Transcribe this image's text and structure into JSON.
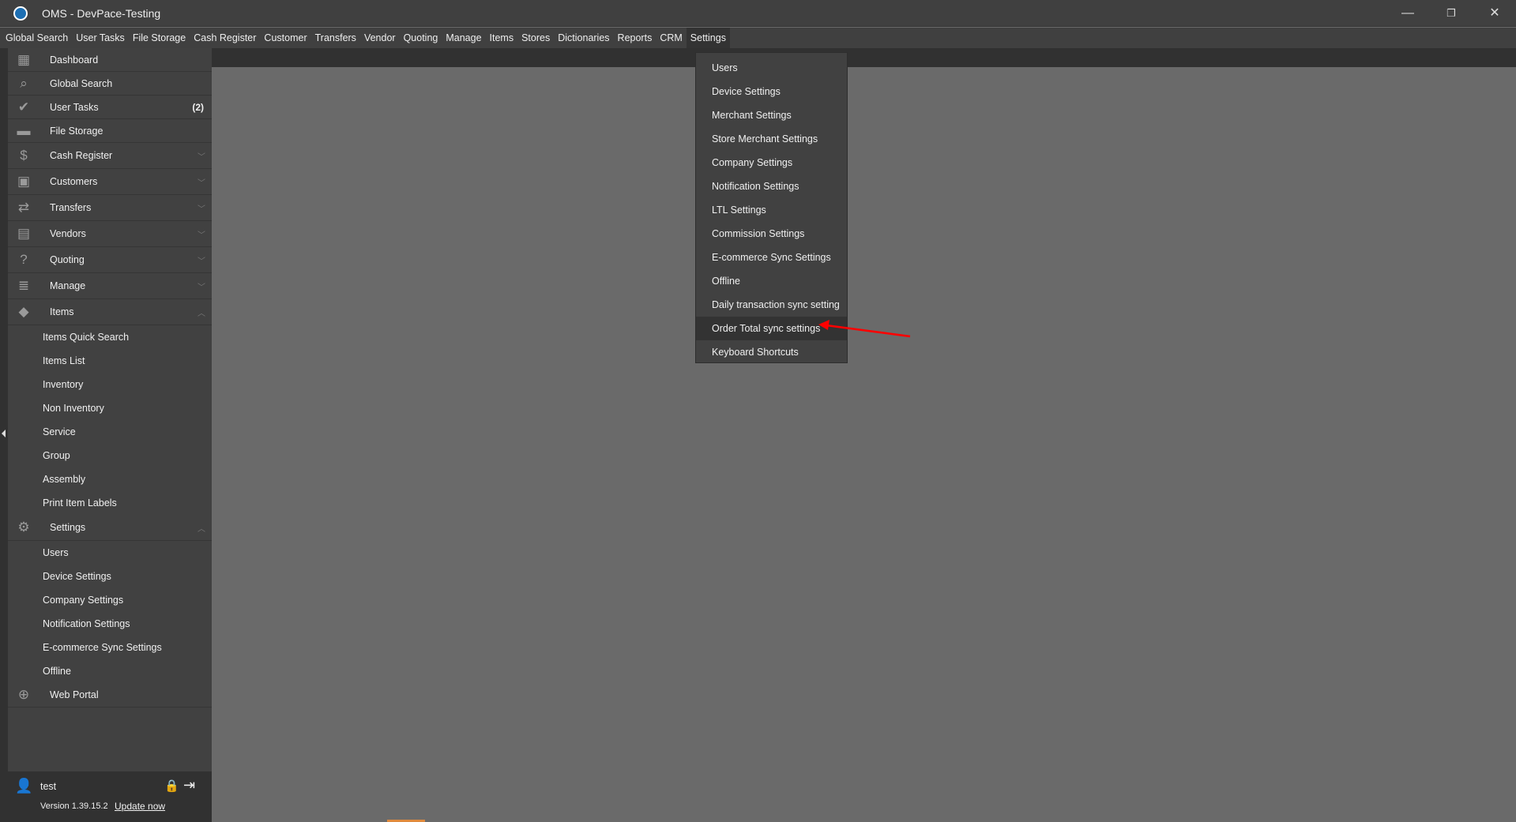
{
  "window": {
    "title": "OMS - DevPace-Testing",
    "minimize": "—",
    "restore": "❐",
    "close": "✕"
  },
  "menubar": [
    "Global Search",
    "User Tasks",
    "File Storage",
    "Cash Register",
    "Customer",
    "Transfers",
    "Vendor",
    "Quoting",
    "Manage",
    "Items",
    "Stores",
    "Dictionaries",
    "Reports",
    "CRM",
    "Settings"
  ],
  "sidebar": {
    "top": [
      {
        "label": "Dashboard",
        "icon": "dashboard-icon"
      },
      {
        "label": "Global Search",
        "icon": "search-icon"
      },
      {
        "label": "User Tasks",
        "icon": "check-circle-icon",
        "badge": "(2)"
      },
      {
        "label": "File Storage",
        "icon": "folder-icon"
      }
    ],
    "groups": [
      {
        "label": "Cash Register",
        "icon": "dollar-icon"
      },
      {
        "label": "Customers",
        "icon": "contact-icon"
      },
      {
        "label": "Transfers",
        "icon": "transfer-icon"
      },
      {
        "label": "Vendors",
        "icon": "store-icon"
      },
      {
        "label": "Quoting",
        "icon": "clipboard-question-icon"
      },
      {
        "label": "Manage",
        "icon": "clipboard-icon"
      },
      {
        "label": "Items",
        "icon": "tag-icon"
      }
    ],
    "items_sub": [
      "Items Quick Search",
      "Items List",
      "Inventory",
      "Non Inventory",
      "Service",
      "Group",
      "Assembly",
      "Print Item Labels"
    ],
    "settings": {
      "label": "Settings",
      "icon": "gear-icon"
    },
    "settings_sub": [
      "Users",
      "Device Settings",
      "Company Settings",
      "Notification Settings",
      "E-commerce Sync Settings",
      "Offline"
    ],
    "web_portal": {
      "label": "Web Portal",
      "icon": "globe-icon"
    },
    "user": {
      "name": "test",
      "version": "Version 1.39.15.2",
      "update": "Update now"
    }
  },
  "settings_menu": [
    "Users",
    "Device Settings",
    "Merchant Settings",
    "Store Merchant Settings",
    "Company Settings",
    "Notification Settings",
    "LTL Settings",
    "Commission Settings",
    "E-commerce Sync Settings",
    "Offline",
    "Daily transaction sync setting",
    "Order Total sync settings",
    "Keyboard Shortcuts"
  ],
  "colors": {
    "annotation_arrow": "#ff0000",
    "highlight": "#333333"
  }
}
